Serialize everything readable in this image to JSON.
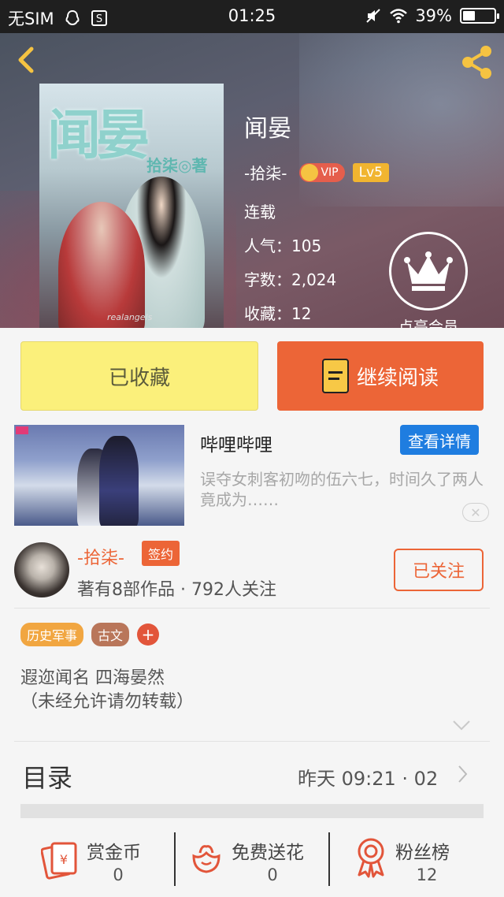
{
  "status_bar": {
    "carrier": "无SIM",
    "time": "01:25",
    "battery": "39%",
    "battery_level": 0.39,
    "icons": [
      "qq-icon",
      "s-box-icon",
      "mute-icon",
      "wifi-icon",
      "battery-icon"
    ]
  },
  "header": {
    "back_icon": "chevron-left-icon",
    "share_icon": "share-icon",
    "accent": "#f5c342"
  },
  "book": {
    "cover_title": "闻晏",
    "cover_author": "拾柒◎著",
    "cover_signature": "realangels",
    "title": "闻晏",
    "author": "-拾柒-",
    "vip_label": "VIP",
    "level": "Lv5",
    "status": "连载",
    "popularity": "人气：105",
    "word_count": "字数：2,024",
    "favorites": "收藏：12"
  },
  "member": {
    "label": "点亮会员",
    "icon": "crown-icon"
  },
  "actions": {
    "collected_label": "已收藏",
    "read_label": "继续阅读",
    "collected_color": "#fbf07b",
    "read_color": "#ec6537"
  },
  "ad": {
    "title": "哔哩哔哩",
    "button_label": "查看详情",
    "description": "误夺女刺客初吻的伍六七，时间久了两人竟成为……",
    "close_icon": "close-icon",
    "button_color": "#1f7de0"
  },
  "author_block": {
    "name": "-拾柒-",
    "sign_label": "签约",
    "stats": "著有8部作品 · 792人关注",
    "follow_label": "已关注"
  },
  "tags": [
    {
      "label": "历史军事",
      "color": "#f1a641"
    },
    {
      "label": "古文",
      "color": "#b9765a"
    }
  ],
  "tag_add_label": "+",
  "intro": {
    "line1": "遐迩闻名 四海晏然",
    "line2": "（未经允许请勿转载）"
  },
  "toc": {
    "title": "目录",
    "info": "昨天 09:21 · 02"
  },
  "bottom_bar": {
    "items": [
      {
        "label": "赏金币",
        "value": "0",
        "icon": "red-envelope-icon"
      },
      {
        "label": "免费送花",
        "value": "0",
        "icon": "flower-icon"
      },
      {
        "label": "粉丝榜",
        "value": "12",
        "icon": "medal-icon"
      }
    ],
    "icon_color": "#e2553a"
  }
}
